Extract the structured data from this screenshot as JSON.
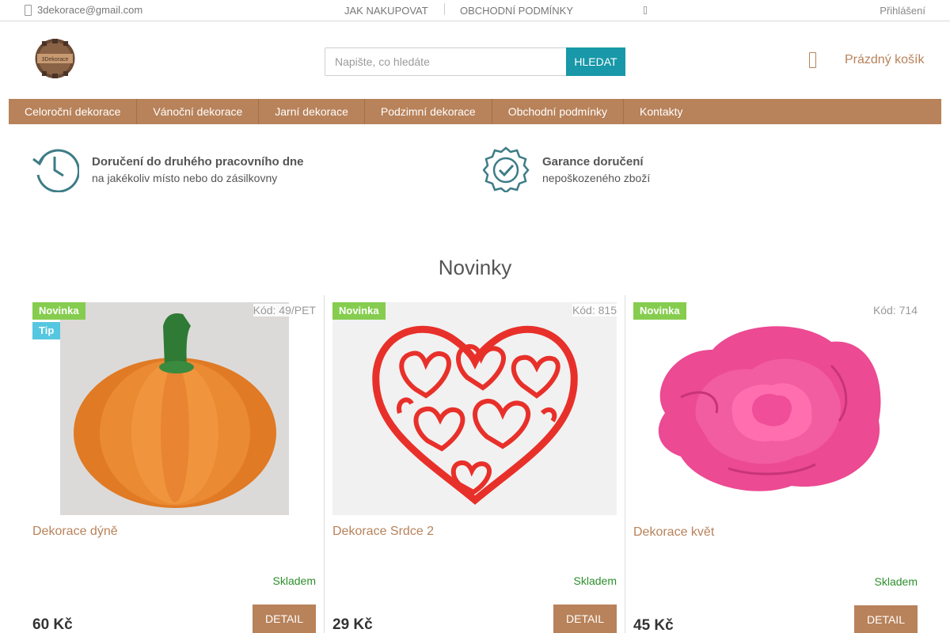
{
  "topbar": {
    "email": "3dekorace@gmail.com",
    "links": [
      "JAK NAKUPOVAT",
      "OBCHODNÍ PODMÍNKY"
    ],
    "login": "Přihlášení"
  },
  "search": {
    "placeholder": "Napište, co hledáte",
    "button_label": "HLEDAT"
  },
  "cart": {
    "label": "Prázdný košík",
    "icon": "cart-icon"
  },
  "logo": {
    "text": "3Dekorace"
  },
  "menu": [
    "Celoroční dekorace",
    "Vánoční dekorace",
    "Jarní dekorace",
    "Podzimní dekorace",
    "Obchodní podmínky",
    "Kontakty"
  ],
  "benefits": [
    {
      "icon": "clock-history-icon",
      "title": "Doručení do druhého pracovního dne",
      "subtitle": "na jakékoliv místo nebo do zásilkovny"
    },
    {
      "icon": "badge-check-icon",
      "title": "Garance doručení",
      "subtitle": "nepoškozeného zboží"
    }
  ],
  "section_title": "Novinky",
  "products": [
    {
      "name": "Dekorace dýně",
      "code": "Kód: 49/PET",
      "badges": [
        "Novinka",
        "Tip"
      ],
      "availability": "Skladem",
      "price": "60 Kč",
      "button": "DETAIL",
      "image": "pumpkin"
    },
    {
      "name": "Dekorace Srdce 2",
      "code": "Kód: 815",
      "badges": [
        "Novinka"
      ],
      "availability": "Skladem",
      "price": "29 Kč",
      "button": "DETAIL",
      "image": "heart"
    },
    {
      "name": "Dekorace květ",
      "code": "Kód: 714",
      "badges": [
        "Novinka"
      ],
      "availability": "Skladem",
      "price": "45 Kč",
      "button": "DETAIL",
      "image": "rose"
    }
  ],
  "colors": {
    "brand": "#b8825a",
    "search_button": "#1898a8",
    "badge_new": "#86cd4f",
    "badge_tip": "#56c7e0",
    "in_stock": "#2c8e2c"
  }
}
